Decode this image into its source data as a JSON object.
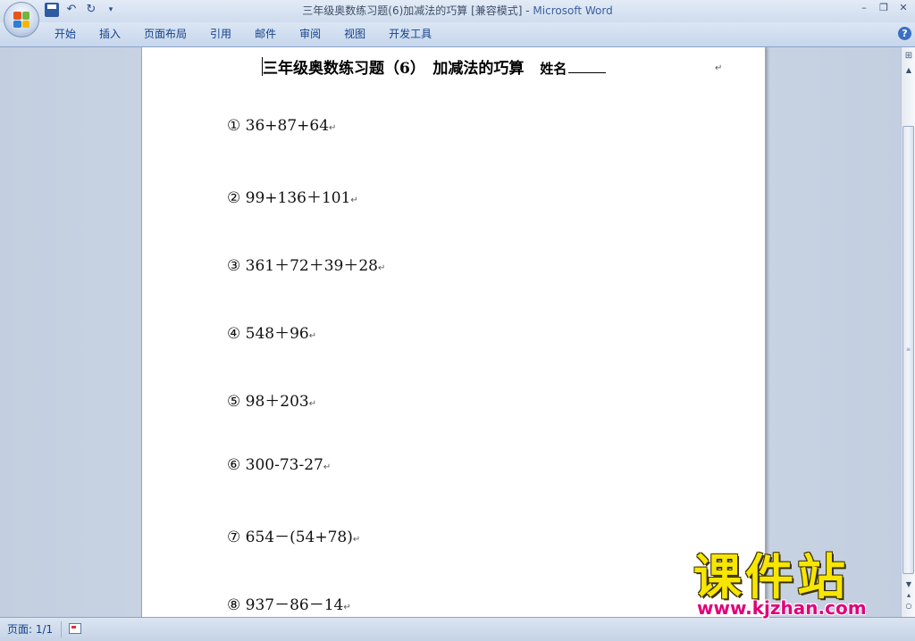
{
  "window": {
    "title_main": "三年级奥数练习题(6)加减法的巧算 [兼容模式] - ",
    "title_brand": "Microsoft Word"
  },
  "ribbon": {
    "tabs": [
      {
        "label": "开始"
      },
      {
        "label": "插入"
      },
      {
        "label": "页面布局"
      },
      {
        "label": "引用"
      },
      {
        "label": "邮件"
      },
      {
        "label": "审阅"
      },
      {
        "label": "视图"
      },
      {
        "label": "开发工具"
      }
    ]
  },
  "document": {
    "title": "三年级奥数练习题（6）　加减法的巧算",
    "name_label": "姓名",
    "para_mark": "↵",
    "problems": [
      {
        "text": "① 36+87+64"
      },
      {
        "text": "② 99+136＋101"
      },
      {
        "text": "③ 361＋72＋39＋28"
      },
      {
        "text": "④ 548＋96"
      },
      {
        "text": "⑤ 98＋203"
      },
      {
        "text": "⑥ 300-73-27"
      },
      {
        "text": "⑦ 654－(54+78)"
      },
      {
        "text": "⑧ 937－86－14"
      }
    ]
  },
  "statusbar": {
    "page_info": "页面: 1/1"
  },
  "watermark": {
    "chars": "课件站",
    "url": "www.kjzhan.com"
  },
  "icons": {
    "undo": "undo-icon",
    "redo": "redo-icon",
    "save": "save-icon",
    "help": "help-icon"
  },
  "colors": {
    "tab_text": "#15428b",
    "watermark_yellow": "#f7e600",
    "watermark_magenta": "#e0007a"
  }
}
